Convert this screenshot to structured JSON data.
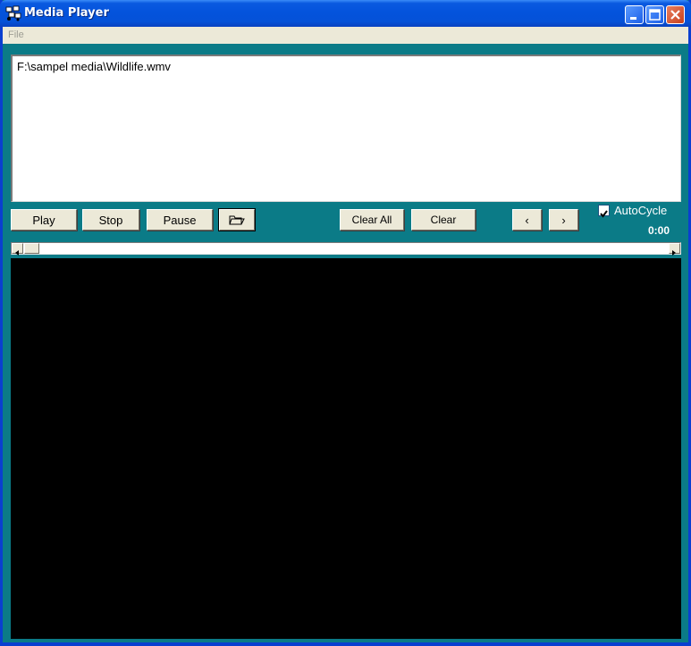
{
  "window": {
    "title": "Media Player",
    "icon": "media-player-icon",
    "frame_color": "#0a3fd0",
    "client_color": "#0b7b87"
  },
  "menu": {
    "items": [
      "File"
    ]
  },
  "playlist": {
    "items": [
      "F:\\sampel media\\Wildlife.wmv"
    ]
  },
  "controls": {
    "play": "Play",
    "stop": "Stop",
    "pause": "Pause",
    "open_icon": "folder-open-icon",
    "clear_all": "Clear All",
    "clear": "Clear",
    "prev": "‹",
    "next": "›"
  },
  "autocycle": {
    "label": "AutoCycle",
    "checked": true
  },
  "time": "0:00",
  "seek": {
    "position": 0
  }
}
